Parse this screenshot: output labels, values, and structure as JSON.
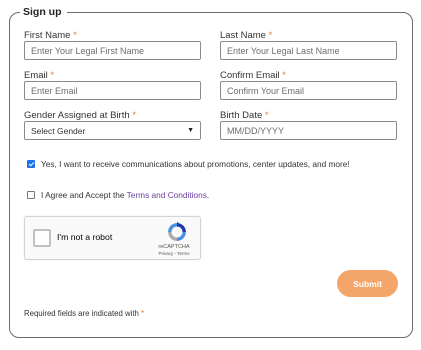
{
  "form": {
    "legend": "Sign up",
    "required_mark": "*",
    "first_name": {
      "label": "First Name",
      "placeholder": "Enter Your Legal First Name",
      "value": ""
    },
    "last_name": {
      "label": "Last Name",
      "placeholder": "Enter Your Legal Last Name",
      "value": ""
    },
    "email": {
      "label": "Email",
      "placeholder": "Enter Email",
      "value": ""
    },
    "confirm_email": {
      "label": "Confirm Email",
      "placeholder": "Confirm Your Email",
      "value": ""
    },
    "gender": {
      "label": "Gender Assigned at Birth",
      "selected": "Select Gender"
    },
    "birth_date": {
      "label": "Birth Date",
      "placeholder": "MM/DD/YYYY",
      "value": ""
    },
    "communications": {
      "label": "Yes, I want to receive communications about promotions, center updates, and more!",
      "checked": true
    },
    "terms": {
      "prefix": "I Agree and Accept the ",
      "link": "Terms and Conditions",
      "suffix": ".",
      "checked": false
    },
    "captcha": {
      "label": "I'm not a robot",
      "brand": "reCAPTCHA",
      "links": "Privacy - Terms"
    },
    "submit_label": "Submit",
    "footnote": "Required fields are indicated with "
  },
  "colors": {
    "accent": "#f4a66a",
    "required": "#e8763a",
    "checkbox": "#1a73e8",
    "link": "#6b3fa0"
  },
  "icons": {
    "select_caret": "chevron-down-icon",
    "captcha_logo": "recaptcha-icon"
  }
}
